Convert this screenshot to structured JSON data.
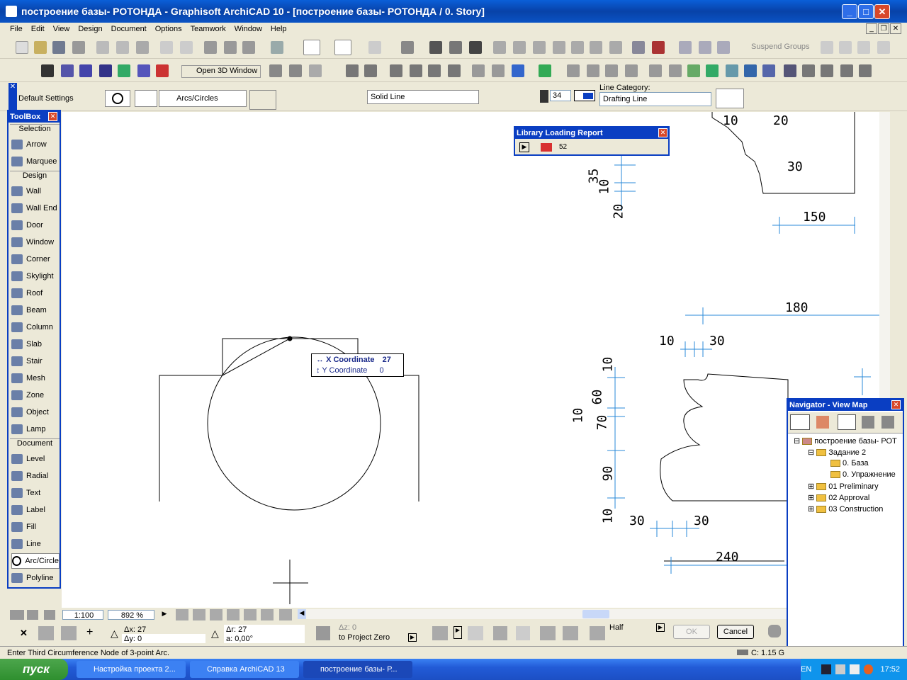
{
  "window": {
    "title": "построение базы- РОТОНДА - Graphisoft ArchiCAD 10 - [построение базы- РОТОНДА / 0. Story]"
  },
  "menu": [
    "File",
    "Edit",
    "View",
    "Design",
    "Document",
    "Options",
    "Teamwork",
    "Window",
    "Help"
  ],
  "toolbar": {
    "suspend_groups": "Suspend Groups",
    "open_3d": "Open 3D Window"
  },
  "infobox": {
    "default_settings": "Default Settings",
    "geometry_method": "Arcs/Circles",
    "line_type": "Solid Line",
    "pen_number": "34",
    "line_category_label": "Line Category:",
    "line_category_value": "Drafting Line"
  },
  "toolbox": {
    "title": "ToolBox",
    "sections": {
      "selection": "Selection",
      "design": "Design",
      "document": "Document"
    },
    "selection_items": [
      "Arrow",
      "Marquee"
    ],
    "design_items": [
      "Wall",
      "Wall End",
      "Door",
      "Window",
      "Corner",
      "Skylight",
      "Roof",
      "Beam",
      "Column",
      "Slab",
      "Stair",
      "Mesh",
      "Zone",
      "Object",
      "Lamp"
    ],
    "document_items": [
      "Level",
      "Radial",
      "Text",
      "Label",
      "Fill",
      "Line",
      "Arc/Circle",
      "Polyline"
    ]
  },
  "library_report": {
    "title": "Library Loading Report",
    "count": "52"
  },
  "tracker": {
    "x_label": "X Coordinate",
    "x_value": "27",
    "y_label": "Y Coordinate",
    "y_value": "0"
  },
  "dimensions": {
    "d10a": "10",
    "d20a": "20",
    "d30a": "30",
    "d35": "35",
    "d10b": "10",
    "d20b": "20",
    "d150": "150",
    "d180": "180",
    "d10c": "10",
    "d30b": "30",
    "d10d": "10",
    "d60": "60",
    "d10e": "10",
    "d70": "70",
    "d90": "90",
    "d10f": "10",
    "d30c": "30",
    "d30d": "30",
    "d240": "240"
  },
  "navigator": {
    "title": "Navigator - View Map",
    "root": "построение базы- РОТ",
    "items": [
      "Задание 2",
      "0. База",
      "0. Упражнение",
      "01 Preliminary",
      "02 Approval",
      "03 Construction"
    ]
  },
  "bottom": {
    "scale": "1:100",
    "zoom": "892 %",
    "dx": "Δx: 27",
    "dy": "Δy: 0",
    "dr": "Δr: 27",
    "da": "a: 0,00°",
    "dz": "Δz: 0",
    "to_project_zero": "to Project Zero",
    "half": "Half",
    "ok": "OK",
    "cancel": "Cancel"
  },
  "status": {
    "prompt": "Enter Third Circumference Node of 3-point Arc.",
    "disk": "C: 1.15 G"
  },
  "taskbar": {
    "start": "пуск",
    "tasks": [
      "Настройка проекта 2...",
      "Справка ArchiCAD 13",
      "построение базы- Р..."
    ],
    "lang": "EN",
    "time": "17:52"
  }
}
